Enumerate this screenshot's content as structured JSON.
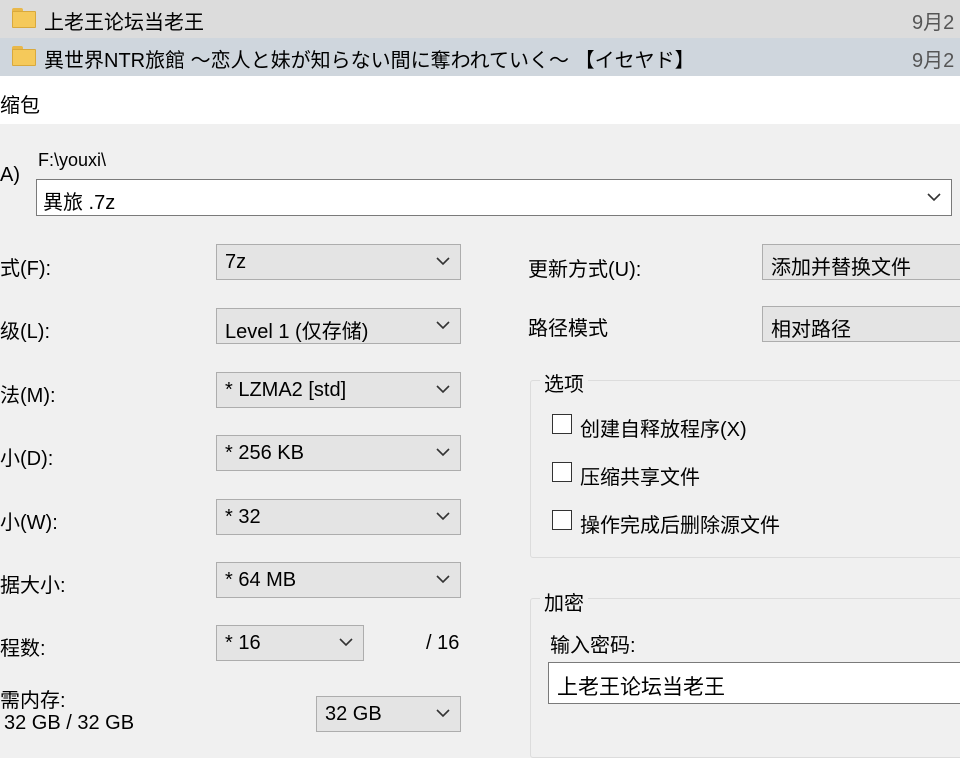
{
  "files": [
    {
      "name": "上老王论坛当老王",
      "date": "9月2"
    },
    {
      "name": "異世界NTR旅館 ～恋人と妹が知らない間に奪われていく～ 【イセヤド】",
      "date": "9月2"
    }
  ],
  "dialog": {
    "title": "缩包"
  },
  "archive": {
    "label": "A)",
    "folder": "F:\\youxi\\",
    "filename": "異旅 .7z"
  },
  "left": {
    "format_label": "式(F):",
    "format_value": "7z",
    "level_label": "级(L):",
    "level_value": "Level 1 (仅存储)",
    "method_label": "法(M):",
    "method_value": "*  LZMA2 [std]",
    "dict_label": "小(D):",
    "dict_value": "*  256 KB",
    "word_label": "小(W):",
    "word_value": "*  32",
    "solid_label": "据大小:",
    "solid_value": "*  64 MB",
    "threads_label": "程数:",
    "threads_value": "*  16",
    "threads_max": "/ 16",
    "memory_label": "需内存:",
    "memory_usage": "32 GB / 32 GB",
    "memory_value": "32 GB"
  },
  "right": {
    "update_label": "更新方式(U):",
    "update_value": "添加并替换文件",
    "path_label": "路径模式",
    "path_value": "相对路径",
    "options_title": "选项",
    "opt_sfx": "创建自释放程序(X)",
    "opt_shared": "压缩共享文件",
    "opt_delete": "操作完成后删除源文件",
    "encrypt_title": "加密",
    "password_label": "输入密码:",
    "password_value": "上老王论坛当老王"
  }
}
